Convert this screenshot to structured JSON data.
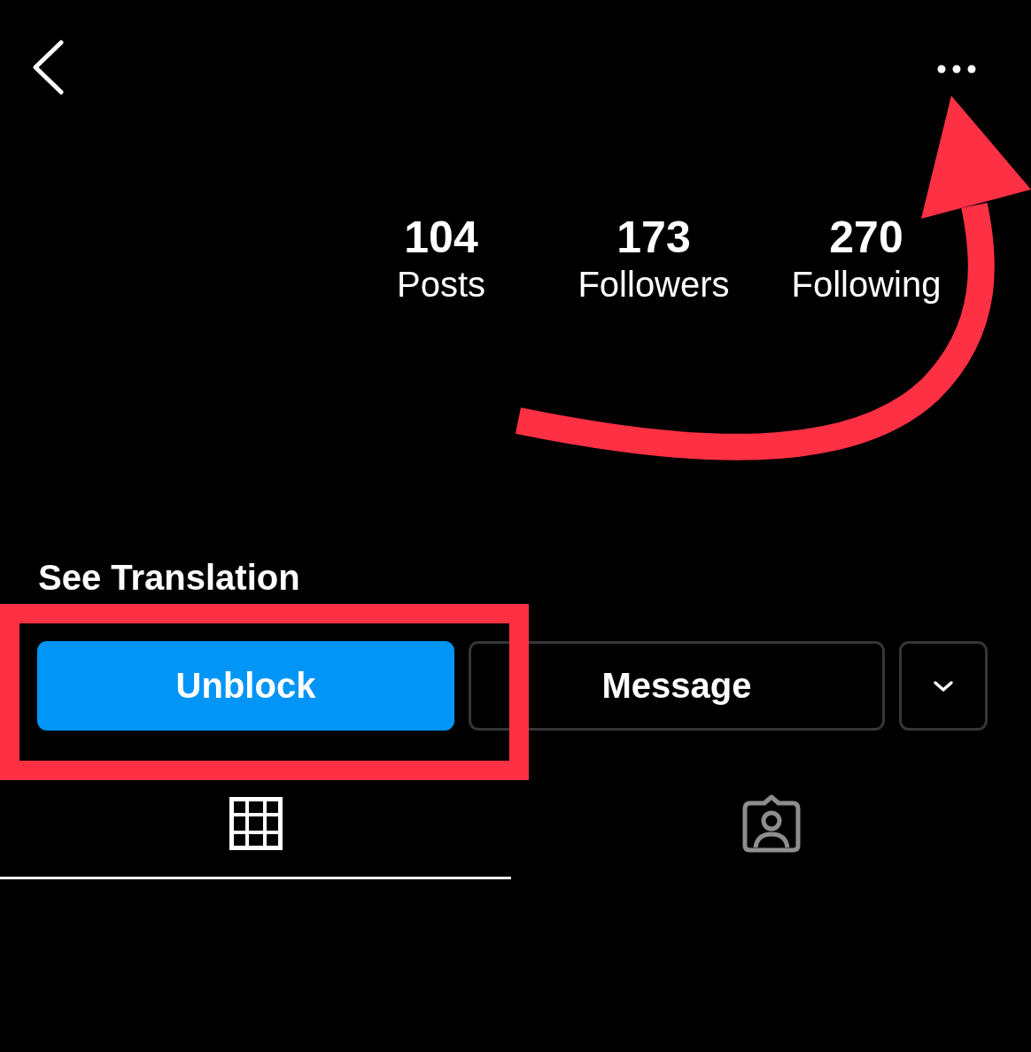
{
  "stats": [
    {
      "count": "104",
      "label": "Posts"
    },
    {
      "count": "173",
      "label": "Followers"
    },
    {
      "count": "270",
      "label": "Following"
    }
  ],
  "see_translation": "See Translation",
  "buttons": [
    {
      "kind": "primary",
      "label": "Unblock"
    },
    {
      "kind": "secondary",
      "label": "Message"
    },
    {
      "kind": "dropdown"
    }
  ],
  "tabs": [
    {
      "kind": "grid",
      "selected": true
    },
    {
      "kind": "tagged",
      "selected": false
    }
  ],
  "annotations": {
    "arrow_to_menu": true,
    "box_around_unblock": true
  }
}
